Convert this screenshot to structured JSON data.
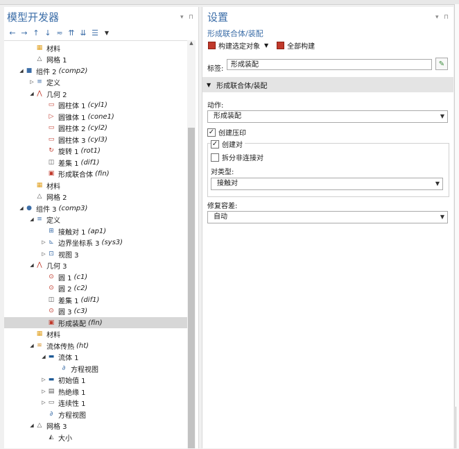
{
  "left_panel": {
    "title": "模型开发器",
    "tree": [
      {
        "label": "材料",
        "it": "",
        "icon": "materials-icon"
      },
      {
        "label": "网格 1",
        "it": "",
        "icon": "mesh-icon"
      },
      {
        "label": "组件 2",
        "it": "(comp2)",
        "icon": "component-icon"
      },
      {
        "label": "定义",
        "it": "",
        "icon": "definitions-icon"
      },
      {
        "label": "几何 2",
        "it": "",
        "icon": "geometry-icon"
      },
      {
        "label": "圆柱体 1",
        "it": "(cyl1)",
        "icon": "cylinder-icon"
      },
      {
        "label": "圆锥体 1",
        "it": "(cone1)",
        "icon": "cone-icon"
      },
      {
        "label": "圆柱体 2",
        "it": "(cyl2)",
        "icon": "cylinder-icon"
      },
      {
        "label": "圆柱体 3",
        "it": "(cyl3)",
        "icon": "cylinder-icon"
      },
      {
        "label": "旋转 1",
        "it": "(rot1)",
        "icon": "rotate-icon"
      },
      {
        "label": "差集 1",
        "it": "(dif1)",
        "icon": "difference-icon"
      },
      {
        "label": "形成联合体",
        "it": "(fin)",
        "icon": "form-union-icon"
      },
      {
        "label": "材料",
        "it": "",
        "icon": "materials-icon"
      },
      {
        "label": "网格 2",
        "it": "",
        "icon": "mesh-icon"
      },
      {
        "label": "组件 3",
        "it": "(comp3)",
        "icon": "component-icon"
      },
      {
        "label": "定义",
        "it": "",
        "icon": "definitions-icon"
      },
      {
        "label": "接触对 1",
        "it": "(ap1)",
        "icon": "contact-pair-icon"
      },
      {
        "label": "边界坐标系 3",
        "it": "(sys3)",
        "icon": "coordinate-system-icon"
      },
      {
        "label": "视图 3",
        "it": "",
        "icon": "view-icon"
      },
      {
        "label": "几何 3",
        "it": "",
        "icon": "geometry-icon"
      },
      {
        "label": "圆 1",
        "it": "(c1)",
        "icon": "circle-icon"
      },
      {
        "label": "圆 2",
        "it": "(c2)",
        "icon": "circle-icon"
      },
      {
        "label": "差集 1",
        "it": "(dif1)",
        "icon": "difference-icon"
      },
      {
        "label": "圆 3",
        "it": "(c3)",
        "icon": "circle-icon"
      },
      {
        "label": "形成装配",
        "it": "(fin)",
        "icon": "form-assembly-icon"
      },
      {
        "label": "材料",
        "it": "",
        "icon": "materials-icon"
      },
      {
        "label": "流体传热",
        "it": "(ht)",
        "icon": "heat-transfer-icon"
      },
      {
        "label": "流体 1",
        "it": "",
        "icon": "fluid-icon"
      },
      {
        "label": "方程视图",
        "it": "",
        "icon": "equation-view-icon"
      },
      {
        "label": "初始值 1",
        "it": "",
        "icon": "initial-values-icon"
      },
      {
        "label": "热绝缘 1",
        "it": "",
        "icon": "thermal-insulation-icon"
      },
      {
        "label": "连续性 1",
        "it": "",
        "icon": "continuity-icon"
      },
      {
        "label": "方程视图",
        "it": "",
        "icon": "equation-view-icon"
      },
      {
        "label": "网格 3",
        "it": "",
        "icon": "mesh-icon"
      },
      {
        "label": "大小",
        "it": "",
        "icon": "size-icon"
      }
    ]
  },
  "right_panel": {
    "title": "设置",
    "subtitle": "形成联合体/装配",
    "build_selected": "构建选定对象",
    "build_all": "全部构建",
    "label_caption": "标签:",
    "label_value": "形成装配",
    "section": "形成联合体/装配",
    "action_caption": "动作:",
    "action_value": "形成装配",
    "create_imprint": "创建压印",
    "create_pairs": "创建对",
    "split_disconnected": "拆分非连接对",
    "pair_type_caption": "对类型:",
    "pair_type_value": "接触对",
    "repair_tolerance_caption": "修复容差:",
    "repair_tolerance_value": "自动"
  },
  "colors": {
    "accent": "#3c6ea8",
    "selection": "#d7d7d7",
    "build_red": "#c0392b"
  }
}
